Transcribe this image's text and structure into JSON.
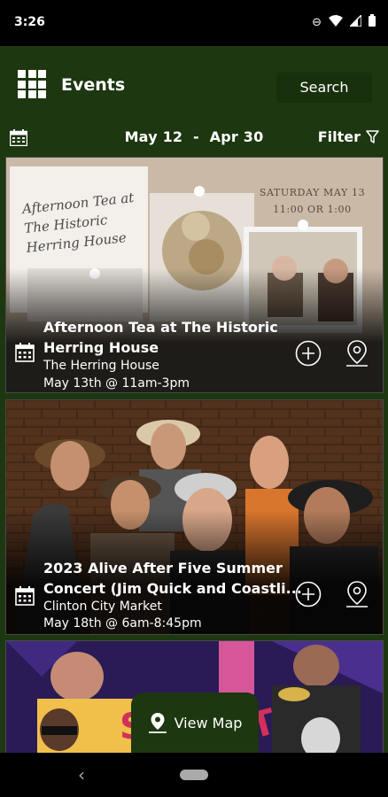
{
  "status": {
    "time": "3:26"
  },
  "header": {
    "title": "Events",
    "search_label": "Search"
  },
  "date_bar": {
    "start": "May 12",
    "separator": "-",
    "end": "Apr 30",
    "filter_label": "Filter"
  },
  "events": [
    {
      "title_line1": "Afternoon Tea at The Historic",
      "title_line2": "Herring House",
      "venue": "The Herring House",
      "when": "May 13th @ 11am-3pm",
      "poster_script": "Afternoon Tea at The Historic Herring House",
      "poster_date": "SATURDAY MAY 13",
      "poster_time": "11:00 OR 1:00"
    },
    {
      "title_line1": "2023 Alive After Five Summer",
      "title_line2": "Concert (Jim Quick and Coastli...",
      "venue": "Clinton City Market",
      "when": "May 18th @ 6am-8:45pm"
    },
    {}
  ],
  "view_map": {
    "label": "View Map"
  },
  "colors": {
    "brand_green": "#1d3710",
    "search_bg": "#18300c"
  }
}
